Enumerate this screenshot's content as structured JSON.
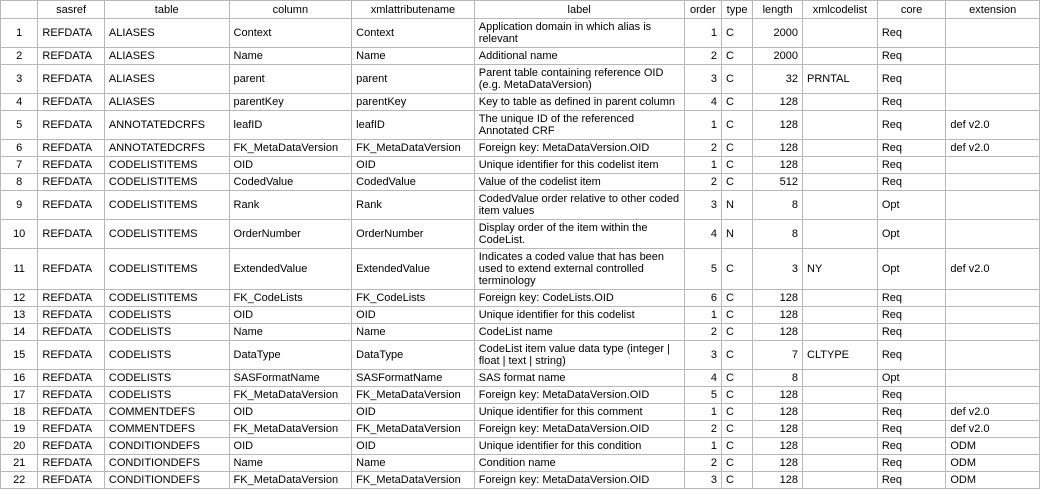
{
  "headers": {
    "rownum": "",
    "sasref": "sasref",
    "table": "table",
    "column": "column",
    "xmlattributename": "xmlattributename",
    "label": "label",
    "order": "order",
    "type": "type",
    "length": "length",
    "xmlcodelist": "xmlcodelist",
    "core": "core",
    "extension": "extension"
  },
  "rows": [
    {
      "n": "1",
      "sasref": "REFDATA",
      "table": "ALIASES",
      "column": "Context",
      "xmlattr": "Context",
      "label": "Application domain in which alias is relevant",
      "order": "1",
      "type": "C",
      "length": "2000",
      "xmlcode": "",
      "core": "Req",
      "ext": ""
    },
    {
      "n": "2",
      "sasref": "REFDATA",
      "table": "ALIASES",
      "column": "Name",
      "xmlattr": "Name",
      "label": "Additional name",
      "order": "2",
      "type": "C",
      "length": "2000",
      "xmlcode": "",
      "core": "Req",
      "ext": ""
    },
    {
      "n": "3",
      "sasref": "REFDATA",
      "table": "ALIASES",
      "column": "parent",
      "xmlattr": "parent",
      "label": "Parent table containing reference OID (e.g. MetaDataVersion)",
      "order": "3",
      "type": "C",
      "length": "32",
      "xmlcode": "PRNTAL",
      "core": "Req",
      "ext": ""
    },
    {
      "n": "4",
      "sasref": "REFDATA",
      "table": "ALIASES",
      "column": "parentKey",
      "xmlattr": "parentKey",
      "label": "Key to table as defined in parent column",
      "order": "4",
      "type": "C",
      "length": "128",
      "xmlcode": "",
      "core": "Req",
      "ext": ""
    },
    {
      "n": "5",
      "sasref": "REFDATA",
      "table": "ANNOTATEDCRFS",
      "column": "leafID",
      "xmlattr": "leafID",
      "label": "The unique ID of the referenced Annotated CRF",
      "order": "1",
      "type": "C",
      "length": "128",
      "xmlcode": "",
      "core": "Req",
      "ext": "def v2.0"
    },
    {
      "n": "6",
      "sasref": "REFDATA",
      "table": "ANNOTATEDCRFS",
      "column": "FK_MetaDataVersion",
      "xmlattr": "FK_MetaDataVersion",
      "label": "Foreign key: MetaDataVersion.OID",
      "order": "2",
      "type": "C",
      "length": "128",
      "xmlcode": "",
      "core": "Req",
      "ext": "def v2.0"
    },
    {
      "n": "7",
      "sasref": "REFDATA",
      "table": "CODELISTITEMS",
      "column": "OID",
      "xmlattr": "OID",
      "label": "Unique identifier for this codelist item",
      "order": "1",
      "type": "C",
      "length": "128",
      "xmlcode": "",
      "core": "Req",
      "ext": ""
    },
    {
      "n": "8",
      "sasref": "REFDATA",
      "table": "CODELISTITEMS",
      "column": "CodedValue",
      "xmlattr": "CodedValue",
      "label": "Value of the codelist item",
      "order": "2",
      "type": "C",
      "length": "512",
      "xmlcode": "",
      "core": "Req",
      "ext": ""
    },
    {
      "n": "9",
      "sasref": "REFDATA",
      "table": "CODELISTITEMS",
      "column": "Rank",
      "xmlattr": "Rank",
      "label": "CodedValue order relative to other coded item values",
      "order": "3",
      "type": "N",
      "length": "8",
      "xmlcode": "",
      "core": "Opt",
      "ext": ""
    },
    {
      "n": "10",
      "sasref": "REFDATA",
      "table": "CODELISTITEMS",
      "column": "OrderNumber",
      "xmlattr": "OrderNumber",
      "label": "Display order of the item within the CodeList.",
      "order": "4",
      "type": "N",
      "length": "8",
      "xmlcode": "",
      "core": "Opt",
      "ext": ""
    },
    {
      "n": "11",
      "sasref": "REFDATA",
      "table": "CODELISTITEMS",
      "column": "ExtendedValue",
      "xmlattr": "ExtendedValue",
      "label": "Indicates a coded value that has been used to extend external controlled terminology",
      "order": "5",
      "type": "C",
      "length": "3",
      "xmlcode": "NY",
      "core": "Opt",
      "ext": "def v2.0"
    },
    {
      "n": "12",
      "sasref": "REFDATA",
      "table": "CODELISTITEMS",
      "column": "FK_CodeLists",
      "xmlattr": "FK_CodeLists",
      "label": "Foreign key: CodeLists.OID",
      "order": "6",
      "type": "C",
      "length": "128",
      "xmlcode": "",
      "core": "Req",
      "ext": ""
    },
    {
      "n": "13",
      "sasref": "REFDATA",
      "table": "CODELISTS",
      "column": "OID",
      "xmlattr": "OID",
      "label": "Unique identifier for this codelist",
      "order": "1",
      "type": "C",
      "length": "128",
      "xmlcode": "",
      "core": "Req",
      "ext": ""
    },
    {
      "n": "14",
      "sasref": "REFDATA",
      "table": "CODELISTS",
      "column": "Name",
      "xmlattr": "Name",
      "label": "CodeList name",
      "order": "2",
      "type": "C",
      "length": "128",
      "xmlcode": "",
      "core": "Req",
      "ext": ""
    },
    {
      "n": "15",
      "sasref": "REFDATA",
      "table": "CODELISTS",
      "column": "DataType",
      "xmlattr": "DataType",
      "label": "CodeList item value data type (integer | float | text | string)",
      "order": "3",
      "type": "C",
      "length": "7",
      "xmlcode": "CLTYPE",
      "core": "Req",
      "ext": ""
    },
    {
      "n": "16",
      "sasref": "REFDATA",
      "table": "CODELISTS",
      "column": "SASFormatName",
      "xmlattr": "SASFormatName",
      "label": "SAS format name",
      "order": "4",
      "type": "C",
      "length": "8",
      "xmlcode": "",
      "core": "Opt",
      "ext": ""
    },
    {
      "n": "17",
      "sasref": "REFDATA",
      "table": "CODELISTS",
      "column": "FK_MetaDataVersion",
      "xmlattr": "FK_MetaDataVersion",
      "label": "Foreign key: MetaDataVersion.OID",
      "order": "5",
      "type": "C",
      "length": "128",
      "xmlcode": "",
      "core": "Req",
      "ext": ""
    },
    {
      "n": "18",
      "sasref": "REFDATA",
      "table": "COMMENTDEFS",
      "column": "OID",
      "xmlattr": "OID",
      "label": "Unique identifier for this comment",
      "order": "1",
      "type": "C",
      "length": "128",
      "xmlcode": "",
      "core": "Req",
      "ext": "def v2.0"
    },
    {
      "n": "19",
      "sasref": "REFDATA",
      "table": "COMMENTDEFS",
      "column": "FK_MetaDataVersion",
      "xmlattr": "FK_MetaDataVersion",
      "label": "Foreign key: MetaDataVersion.OID",
      "order": "2",
      "type": "C",
      "length": "128",
      "xmlcode": "",
      "core": "Req",
      "ext": "def v2.0"
    },
    {
      "n": "20",
      "sasref": "REFDATA",
      "table": "CONDITIONDEFS",
      "column": "OID",
      "xmlattr": "OID",
      "label": "Unique identifier for this condition",
      "order": "1",
      "type": "C",
      "length": "128",
      "xmlcode": "",
      "core": "Req",
      "ext": "ODM"
    },
    {
      "n": "21",
      "sasref": "REFDATA",
      "table": "CONDITIONDEFS",
      "column": "Name",
      "xmlattr": "Name",
      "label": "Condition name",
      "order": "2",
      "type": "C",
      "length": "128",
      "xmlcode": "",
      "core": "Req",
      "ext": "ODM"
    },
    {
      "n": "22",
      "sasref": "REFDATA",
      "table": "CONDITIONDEFS",
      "column": "FK_MetaDataVersion",
      "xmlattr": "FK_MetaDataVersion",
      "label": "Foreign key: MetaDataVersion.OID",
      "order": "3",
      "type": "C",
      "length": "128",
      "xmlcode": "",
      "core": "Req",
      "ext": "ODM"
    }
  ]
}
